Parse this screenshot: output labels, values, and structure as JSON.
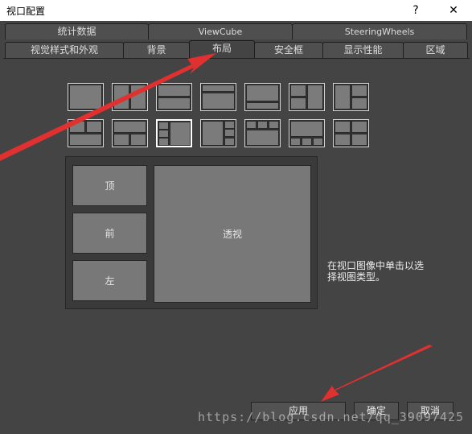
{
  "window": {
    "title": "视口配置",
    "help_glyph": "?",
    "close_glyph": "✕"
  },
  "tabs_row1": [
    {
      "label": "统计数据"
    },
    {
      "label": "ViewCube"
    },
    {
      "label": "SteeringWheels"
    }
  ],
  "tabs_row2": [
    {
      "label": "视觉样式和外观"
    },
    {
      "label": "背景"
    },
    {
      "label": "布局",
      "active": true
    },
    {
      "label": "安全框"
    },
    {
      "label": "显示性能"
    },
    {
      "label": "区域"
    }
  ],
  "preview": {
    "viewports": [
      "顶",
      "前",
      "左",
      "透视"
    ]
  },
  "hint": "在视口图像中单击以选择视图类型。",
  "buttons": {
    "apply": "应用",
    "ok": "确定",
    "cancel": "取消"
  },
  "watermark": "https://blog.csdn.net/qq_39097425",
  "colors": {
    "background": "#444444",
    "arrow": "#e03030"
  }
}
